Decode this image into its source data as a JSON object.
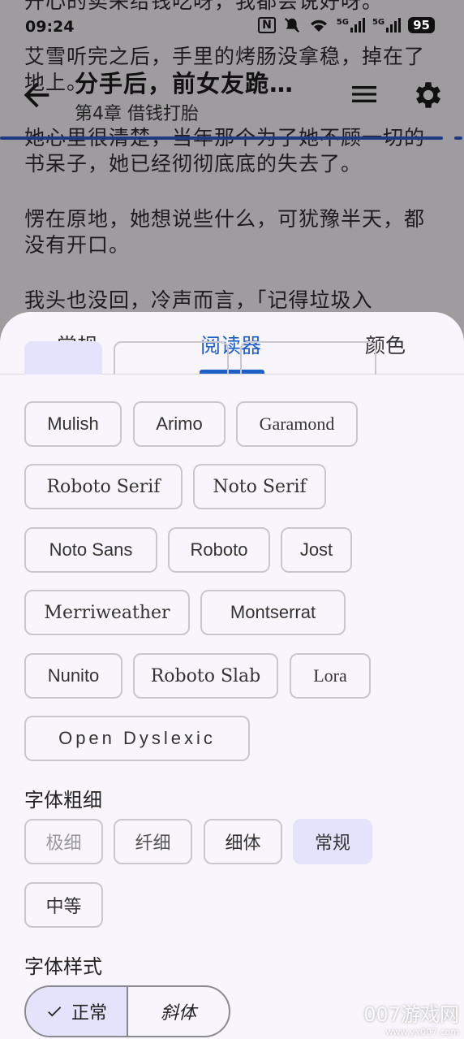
{
  "reader": {
    "lines": [
      "开心的卖采给钱吃呀，我都会说好呀。",
      "艾雪听完之后，手里的烤肠没拿稳，掉在了",
      "地上。",
      "她心里很清楚，当年那个为了她不顾一切的",
      "书呆子，她已经彻彻底底的失去了。",
      "愣在原地，她想说些什么，可犹豫半天，都",
      "没有开口。",
      "我头也没回，冷声而言，「记得垃圾入"
    ]
  },
  "status_bar": {
    "time": "09:24",
    "nfc": "N",
    "signal_1": "5G",
    "signal_2": "5G",
    "battery": "95"
  },
  "app_bar": {
    "title": "分手后，前女友跪…",
    "subtitle": "第4章 借钱打胎"
  },
  "tabs": [
    "常规",
    "阅读器",
    "颜色"
  ],
  "active_tab": "阅读器",
  "fonts": {
    "row_1": [
      "Mulish",
      "Arimo",
      "Garamond"
    ],
    "row_2": [
      "Roboto Serif",
      "Noto Serif"
    ],
    "row_3": [
      "Noto Sans",
      "Roboto",
      "Jost"
    ],
    "row_4": [
      "Merriweather",
      "Montserrat"
    ],
    "row_5": [
      "Nunito",
      "Roboto Slab",
      "Lora"
    ],
    "row_6": [
      "Open Dyslexic"
    ]
  },
  "font_weight": {
    "label": "字体粗细",
    "options": [
      "极细",
      "纤细",
      "细体",
      "常规",
      "中等"
    ],
    "selected": "常规"
  },
  "font_style": {
    "label": "字体样式",
    "options": [
      "正常",
      "斜体"
    ],
    "selected": "正常"
  },
  "watermark": {
    "text": "007游戏网",
    "url": "www.yx007.com"
  },
  "colors": {
    "accent": "#1e5fc8",
    "selected_chip": "#e5e3fb",
    "progress": "#1f3b84"
  }
}
